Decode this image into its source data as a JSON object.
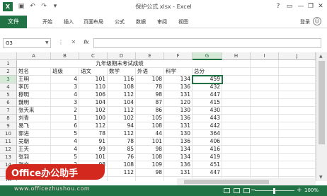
{
  "titlebar": {
    "app_icon": "X",
    "title": "保护公式.xlsx - Excel",
    "help": "?",
    "minimize": "—",
    "restore": "❐",
    "close": "✕"
  },
  "ribbon": {
    "file": "文件",
    "tabs": [
      "开始",
      "插入",
      "页面布局",
      "公式",
      "数据",
      "审阅",
      "视图"
    ],
    "login": "登录",
    "face": "☺"
  },
  "formula_bar": {
    "name_box": "G3",
    "fx": "fx",
    "value": ""
  },
  "sheet": {
    "columns": [
      "A",
      "B",
      "C",
      "D",
      "E",
      "F",
      "G",
      "H",
      "I",
      "J"
    ],
    "rows": [
      "1",
      "2",
      "3",
      "4",
      "5",
      "6",
      "7",
      "8",
      "9",
      "10",
      "11",
      "12",
      "13",
      "14",
      "15",
      "16"
    ],
    "title": "九年级期末考试成绩",
    "headers": [
      "姓名",
      "班级",
      "语文",
      "数学",
      "外语",
      "科学",
      "总分"
    ],
    "data": [
      [
        "王明",
        "4",
        "101",
        "116",
        "108",
        "134",
        "459"
      ],
      [
        "李历",
        "3",
        "110",
        "108",
        "78",
        "136",
        "432"
      ],
      [
        "穆明",
        "4",
        "106",
        "112",
        "98",
        "131",
        "447"
      ],
      [
        "魏明",
        "3",
        "104",
        "104",
        "87",
        "120",
        "415"
      ],
      [
        "张天来",
        "2",
        "102",
        "112",
        "86",
        "130",
        "430"
      ],
      [
        "刘青",
        "1",
        "100",
        "102",
        "105",
        "136",
        "443"
      ],
      [
        "易飞",
        "6",
        "112",
        "94",
        "108",
        "131",
        "442"
      ],
      [
        "郭进",
        "5",
        "78",
        "112",
        "44",
        "130",
        "364"
      ],
      [
        "吴朝",
        "4",
        "91",
        "78",
        "101",
        "136",
        "406"
      ],
      [
        "王天",
        "4",
        "99",
        "85",
        "98",
        "134",
        "416"
      ],
      [
        "张羽",
        "5",
        "101",
        "76",
        "108",
        "134",
        "419"
      ],
      [
        "张文",
        "2",
        "98",
        "108",
        "109",
        "136",
        "451"
      ],
      [
        "",
        "",
        "",
        "112",
        "98",
        "131",
        "447"
      ]
    ]
  },
  "statusbar": {
    "zoom": "100%",
    "zoom_minus": "−",
    "zoom_plus": "+"
  },
  "watermark": {
    "badge": "Office办公助手",
    "url": "www.officezhushou.com"
  }
}
